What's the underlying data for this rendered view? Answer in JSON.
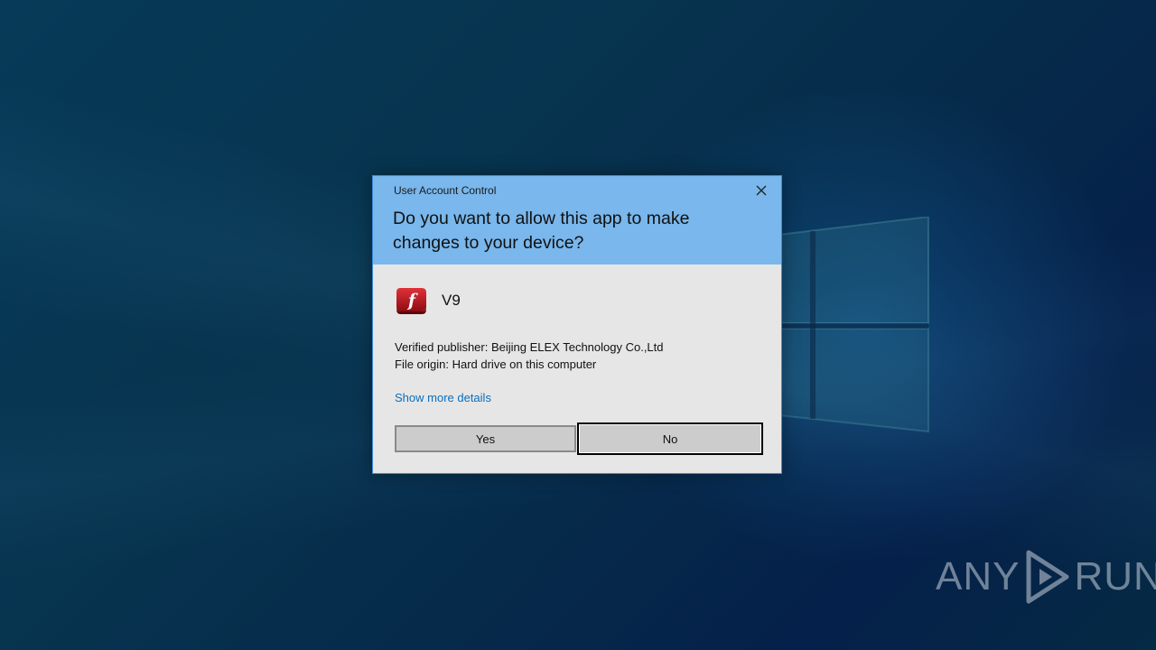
{
  "dialog": {
    "window_title": "User Account Control",
    "question": "Do you want to allow this app to make changes to your device?",
    "app_name": "V9",
    "app_icon": "flash-player-icon",
    "publisher_line": "Verified publisher: Beijing ELEX Technology Co.,Ltd",
    "origin_line": "File origin: Hard drive on this computer",
    "details_link": "Show more details",
    "yes_label": "Yes",
    "no_label": "No",
    "colors": {
      "header": "#79b7ec",
      "body": "#e6e6e6",
      "link": "#0a6ebd"
    }
  },
  "watermark": {
    "left_text": "ANY",
    "right_text": "RUN",
    "icon": "play-triangle-icon"
  },
  "desktop": {
    "logo": "windows-logo-icon"
  }
}
